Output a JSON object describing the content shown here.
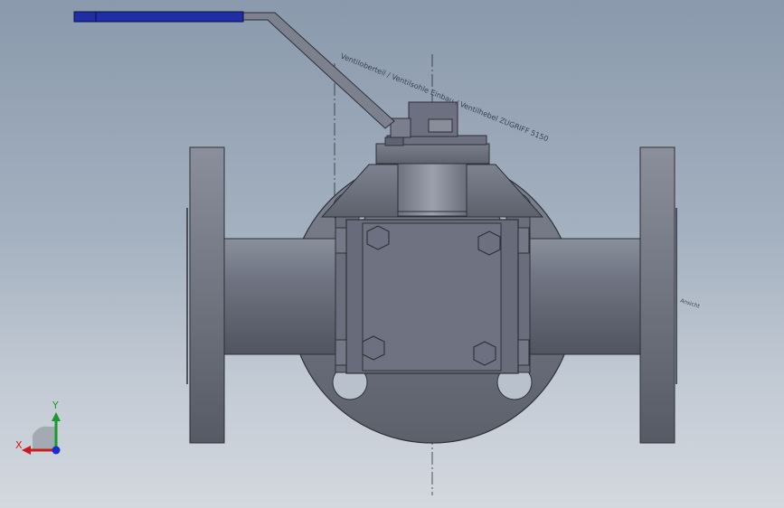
{
  "viewport": {
    "background_top": "#8a99ac",
    "background_bottom": "#d3d8de"
  },
  "model": {
    "component": "three-way ball valve with lever handle",
    "handle_color": "#1f2fa3",
    "body_color": "#6e7380",
    "annotations": {
      "lever_note": "Ventiloberteil / Ventilsohle Einbau / Ventilhebel ZUGRIFF 5150",
      "side_note": "Ansicht"
    }
  },
  "triad": {
    "x_label": "X",
    "y_label": "Y",
    "x_color": "#c81e1e",
    "y_color": "#1a9a2a",
    "z_color": "#1a2ecc"
  }
}
